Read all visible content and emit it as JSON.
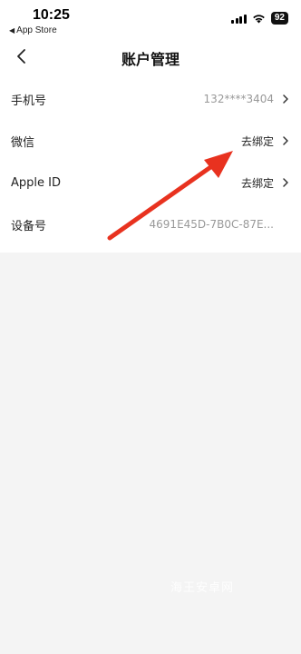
{
  "status_bar": {
    "time": "10:25",
    "back_app_label": "App Store",
    "battery": "92"
  },
  "nav": {
    "title": "账户管理"
  },
  "rows": [
    {
      "label": "手机号",
      "value": "132****3404"
    },
    {
      "label": "微信",
      "value": "去绑定"
    },
    {
      "label": "Apple ID",
      "value": "去绑定"
    },
    {
      "label": "设备号",
      "value": "4691E45D-7B0C-87E..."
    }
  ],
  "watermark": "海王安卓网",
  "colors": {
    "arrow": "#e8321f",
    "background": "#f4f4f4"
  }
}
